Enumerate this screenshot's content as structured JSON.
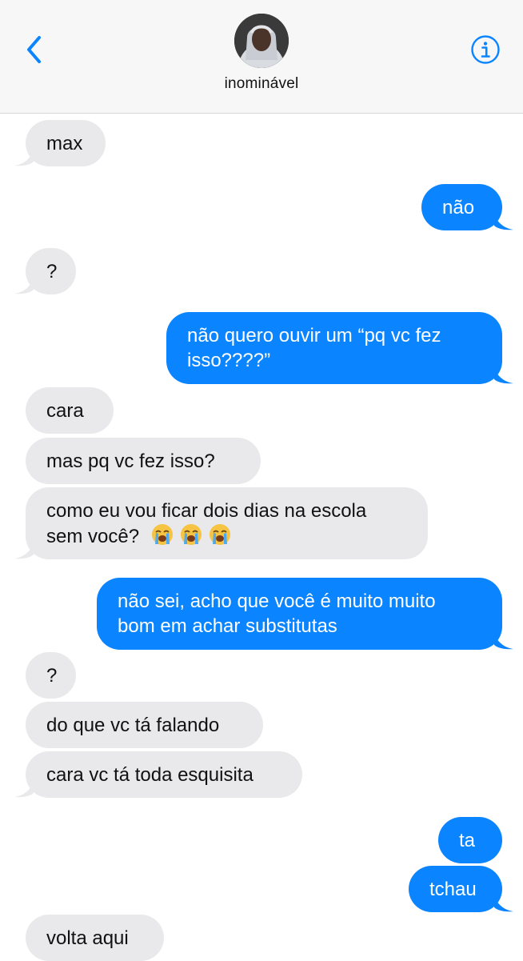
{
  "header": {
    "contact_name": "inominável",
    "back_icon": "chevron-left-icon",
    "info_icon": "info-icon",
    "accent_color": "#0a84ff"
  },
  "messages": [
    {
      "direction": "incoming",
      "lines": [
        "max"
      ]
    },
    {
      "direction": "outgoing",
      "lines": [
        "não"
      ]
    },
    {
      "direction": "incoming",
      "lines": [
        "?"
      ]
    },
    {
      "direction": "outgoing",
      "lines": [
        "não quero ouvir um “pq vc fez",
        "isso????”"
      ]
    },
    {
      "direction": "incoming",
      "lines": [
        "cara"
      ]
    },
    {
      "direction": "incoming",
      "lines": [
        "mas pq vc fez isso?"
      ]
    },
    {
      "direction": "incoming",
      "lines": [
        "como eu vou ficar dois dias na escola",
        "sem você?"
      ],
      "emoji": [
        "loudly-crying-face",
        "loudly-crying-face",
        "loudly-crying-face"
      ]
    },
    {
      "direction": "outgoing",
      "lines": [
        "não sei, acho que você é muito muito",
        "bom em achar substitutas"
      ]
    },
    {
      "direction": "incoming",
      "lines": [
        "?"
      ]
    },
    {
      "direction": "incoming",
      "lines": [
        "do que vc tá falando"
      ]
    },
    {
      "direction": "incoming",
      "lines": [
        "cara vc tá toda esquisita"
      ]
    },
    {
      "direction": "outgoing",
      "lines": [
        "ta"
      ]
    },
    {
      "direction": "outgoing",
      "lines": [
        "tchau"
      ]
    },
    {
      "direction": "incoming",
      "lines": [
        "volta aqui"
      ]
    }
  ]
}
